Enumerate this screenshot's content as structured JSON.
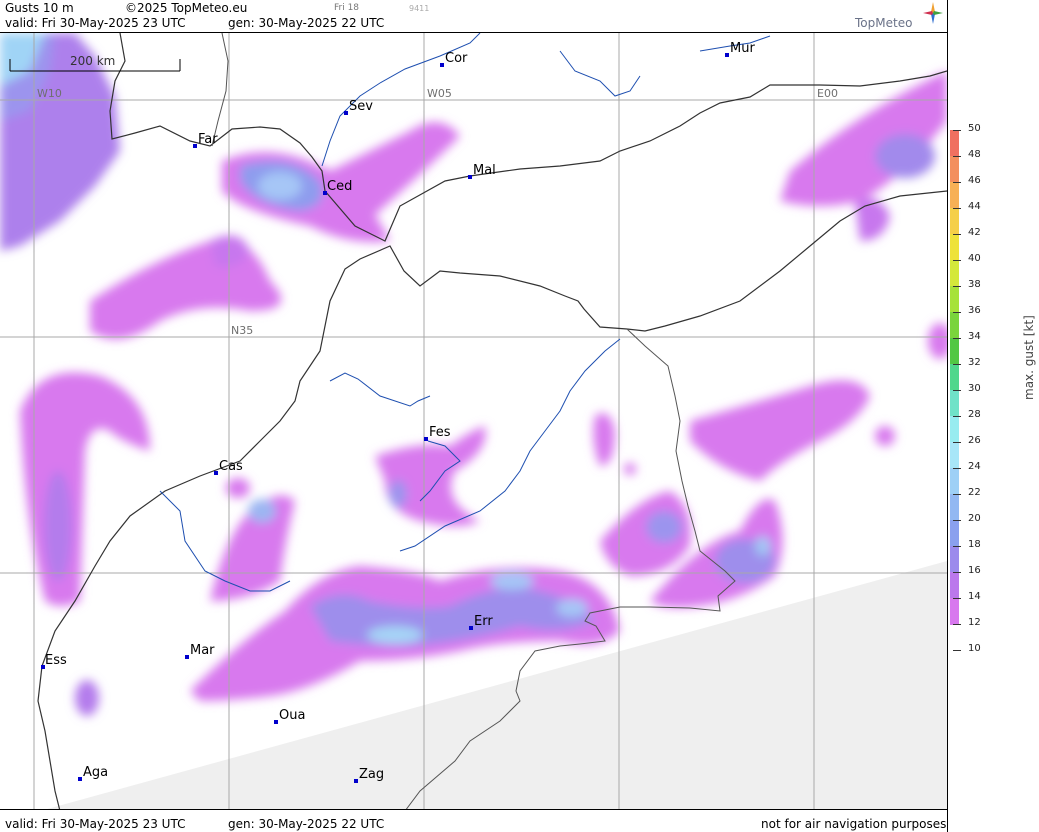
{
  "header": {
    "product": "Gusts 10 m",
    "copyright": "©2025 TopMeteo.eu",
    "tag": "Fri 18",
    "code": "9411",
    "valid": "valid:  Fri  30-May-2025  23 UTC",
    "gen": "gen: 30-May-2025 22 UTC",
    "brand": "TopMeteo"
  },
  "footer": {
    "valid": "valid:  Fri  30-May-2025  23 UTC",
    "gen": "gen: 30-May-2025 22 UTC",
    "disclaimer": "not for air navigation purposes"
  },
  "scale": {
    "label": "200 km"
  },
  "grid_labels": {
    "w10": "W10",
    "w05": "W05",
    "e00": "E00",
    "n35": "N35"
  },
  "cities": [
    "Cor",
    "Mur",
    "Sev",
    "Far",
    "Mal",
    "Ced",
    "Fes",
    "Cas",
    "Err",
    "Mar",
    "Ess",
    "Oua",
    "Aga",
    "Zag"
  ],
  "legend": {
    "title": "max. gust [kt]",
    "ticks": [
      "50",
      "48",
      "46",
      "44",
      "42",
      "40",
      "38",
      "36",
      "34",
      "32",
      "30",
      "28",
      "26",
      "24",
      "22",
      "20",
      "18",
      "16",
      "14",
      "12",
      "10"
    ],
    "colors": [
      "#f07060",
      "#f38f5e",
      "#f7b056",
      "#f5cf48",
      "#eee23a",
      "#d4e83a",
      "#a6e23a",
      "#7ad43c",
      "#52c744",
      "#50d78c",
      "#70e2c8",
      "#98ecf0",
      "#a8e6f8",
      "#9ed0f6",
      "#92b8f2",
      "#8aa0ee",
      "#9c8aec",
      "#bb78ec",
      "#d878ee"
    ],
    "low_color": "#ffffff",
    "accent": "#ec7cf0"
  }
}
